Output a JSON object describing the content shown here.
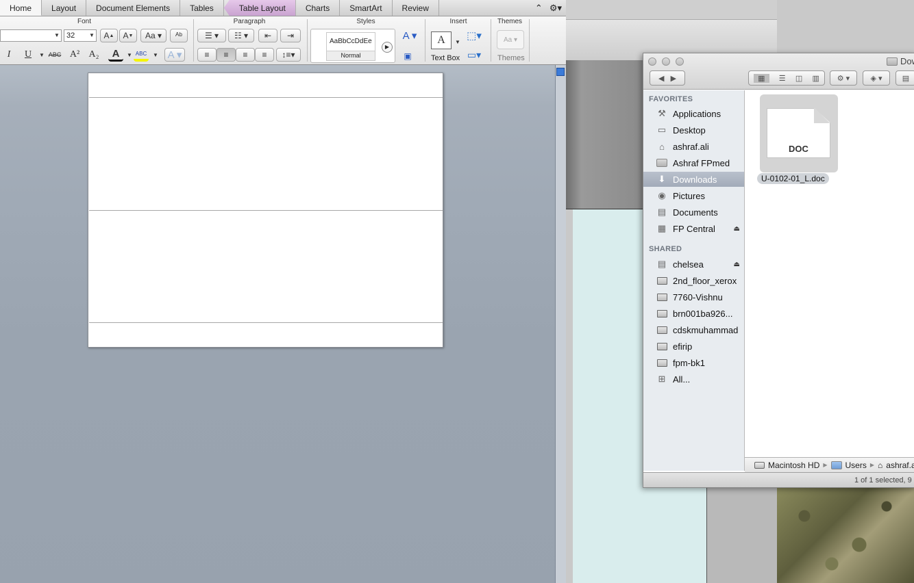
{
  "word": {
    "tabs": [
      {
        "label": "Home",
        "active": true
      },
      {
        "label": "Layout"
      },
      {
        "label": "Document Elements"
      },
      {
        "label": "Tables"
      },
      {
        "label": "Table Layout",
        "contextual": true
      },
      {
        "label": "Charts"
      },
      {
        "label": "SmartArt"
      },
      {
        "label": "Review"
      }
    ],
    "groups": {
      "font": "Font",
      "paragraph": "Paragraph",
      "styles": "Styles",
      "insert": "Insert",
      "themes": "Themes"
    },
    "font_size": "32",
    "font_name": "",
    "style_sample": "AaBbCcDdEe",
    "style_name": "Normal",
    "text_box_label": "Text Box",
    "themes_label": "Themes",
    "format_buttons": {
      "italic": "I",
      "underline": "U",
      "strike": "ABC",
      "superscript": "A²",
      "subscript": "A₂"
    }
  },
  "finder": {
    "title": "Dow",
    "sidebar": {
      "favorites_heading": "FAVORITES",
      "favorites": [
        {
          "label": "Applications",
          "icon": "applications-icon"
        },
        {
          "label": "Desktop",
          "icon": "desktop-icon"
        },
        {
          "label": "ashraf.ali",
          "icon": "home-icon"
        },
        {
          "label": "Ashraf FPmed",
          "icon": "folder-icon"
        },
        {
          "label": "Downloads",
          "icon": "downloads-icon",
          "selected": true
        },
        {
          "label": "Pictures",
          "icon": "camera-icon"
        },
        {
          "label": "Documents",
          "icon": "documents-icon"
        },
        {
          "label": "FP Central",
          "icon": "network-drive-icon",
          "eject": true
        }
      ],
      "shared_heading": "SHARED",
      "shared": [
        {
          "label": "chelsea",
          "icon": "server-icon",
          "eject": true
        },
        {
          "label": "2nd_floor_xerox",
          "icon": "monitor-icon"
        },
        {
          "label": "7760-Vishnu",
          "icon": "monitor-icon"
        },
        {
          "label": "brn001ba926...",
          "icon": "monitor-icon"
        },
        {
          "label": "cdskmuhammad",
          "icon": "monitor-icon"
        },
        {
          "label": "efirip",
          "icon": "monitor-icon"
        },
        {
          "label": "fpm-bk1",
          "icon": "monitor-icon"
        },
        {
          "label": "All...",
          "icon": "network-icon"
        }
      ]
    },
    "file": {
      "name": "U-0102-01_L.doc",
      "badge": "DOC"
    },
    "path": [
      "Macintosh HD",
      "Users",
      "ashraf.ali"
    ],
    "status": "1 of 1 selected, 9"
  }
}
